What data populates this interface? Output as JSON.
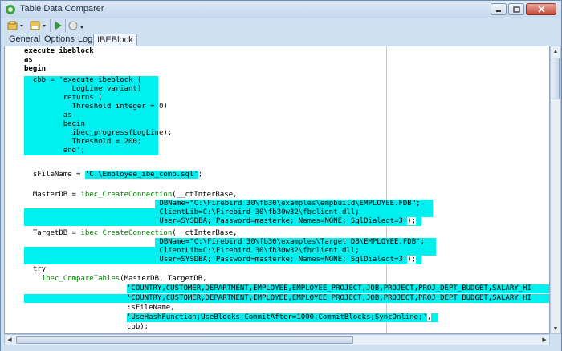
{
  "window": {
    "title": "Table Data Comparer"
  },
  "toolbar": {
    "items": [
      "open-icon",
      "save-icon",
      "run-icon",
      "stop-icon"
    ]
  },
  "tabs": [
    {
      "label": "General"
    },
    {
      "label": "Options"
    },
    {
      "label": "Log"
    },
    {
      "label": "IBEBlock",
      "active": true
    }
  ],
  "colors": {
    "highlight": "#00f0f0",
    "function": "#008000",
    "chrome": "#cfe0f1"
  },
  "code": {
    "l01": "execute ibeblock",
    "l02": "as",
    "l03": "begin",
    "l04a": "  cbb = ",
    "l04b": "'execute ibeblock (",
    "l05": "           LogLine variant)",
    "l06": "         returns (",
    "l07": "           Threshold integer = 0)",
    "l08": "         as",
    "l09": "         begin",
    "l10": "           ibec_progress(LogLine);",
    "l11": "           Threshold = 200;",
    "l12": "         end'",
    "l12b": ";",
    "l14a": "  sFileName = ",
    "l14b": "'C:\\Employee_ibe_comp.sql'",
    "l14c": ";",
    "l16a": "  MasterDB = ",
    "l16b": "ibec_CreateConnection",
    "l16c": "(__ctInterBase,",
    "l17": "'DBName=\"C:\\Firebird 30\\fb30\\examples\\empbuild\\EMPLOYEE.FDB\";",
    "l18": " ClientLib=C:\\Firebird 30\\fb30w32\\fbclient.dll;",
    "l19": " User=SYSDBA; Password=masterke; Names=NONE; SqlDialect=3'",
    "l19b": ");",
    "l20a": "  TargetDB = ",
    "l20b": "ibec_CreateConnection",
    "l20c": "(__ctInterBase,",
    "l21": "'DBName=\"C:\\Firebird 30\\fb30\\examples\\Target DB\\EMPLOYEE.FDB\";",
    "l22": " ClientLib=C:\\Firebird 30\\fb30w32\\fbclient.dll;",
    "l23": " User=SYSDBA; Password=masterke; Names=NONE; SqlDialect=3'",
    "l23b": ");",
    "l24": "  try",
    "l25a": "    ",
    "l25b": "ibec_CompareTables",
    "l25c": "(MasterDB, TargetDB,",
    "l26": "'COUNTRY,CUSTOMER,DEPARTMENT,EMPLOYEE,EMPLOYEE_PROJECT,JOB,PROJECT,PROJ_DEPT_BUDGET,SALARY_HI",
    "l27": "'COUNTRY,CUSTOMER,DEPARTMENT,EMPLOYEE,EMPLOYEE_PROJECT,JOB,PROJECT,PROJ_DEPT_BUDGET,SALARY_HI",
    "l28": ":sFileName,",
    "l29": "'UseHashFunction;UseBlocks;CommitAfter=1000;CommitBlocks;SyncOnline;'",
    "l29b": ",",
    "l30": "cbb);"
  }
}
